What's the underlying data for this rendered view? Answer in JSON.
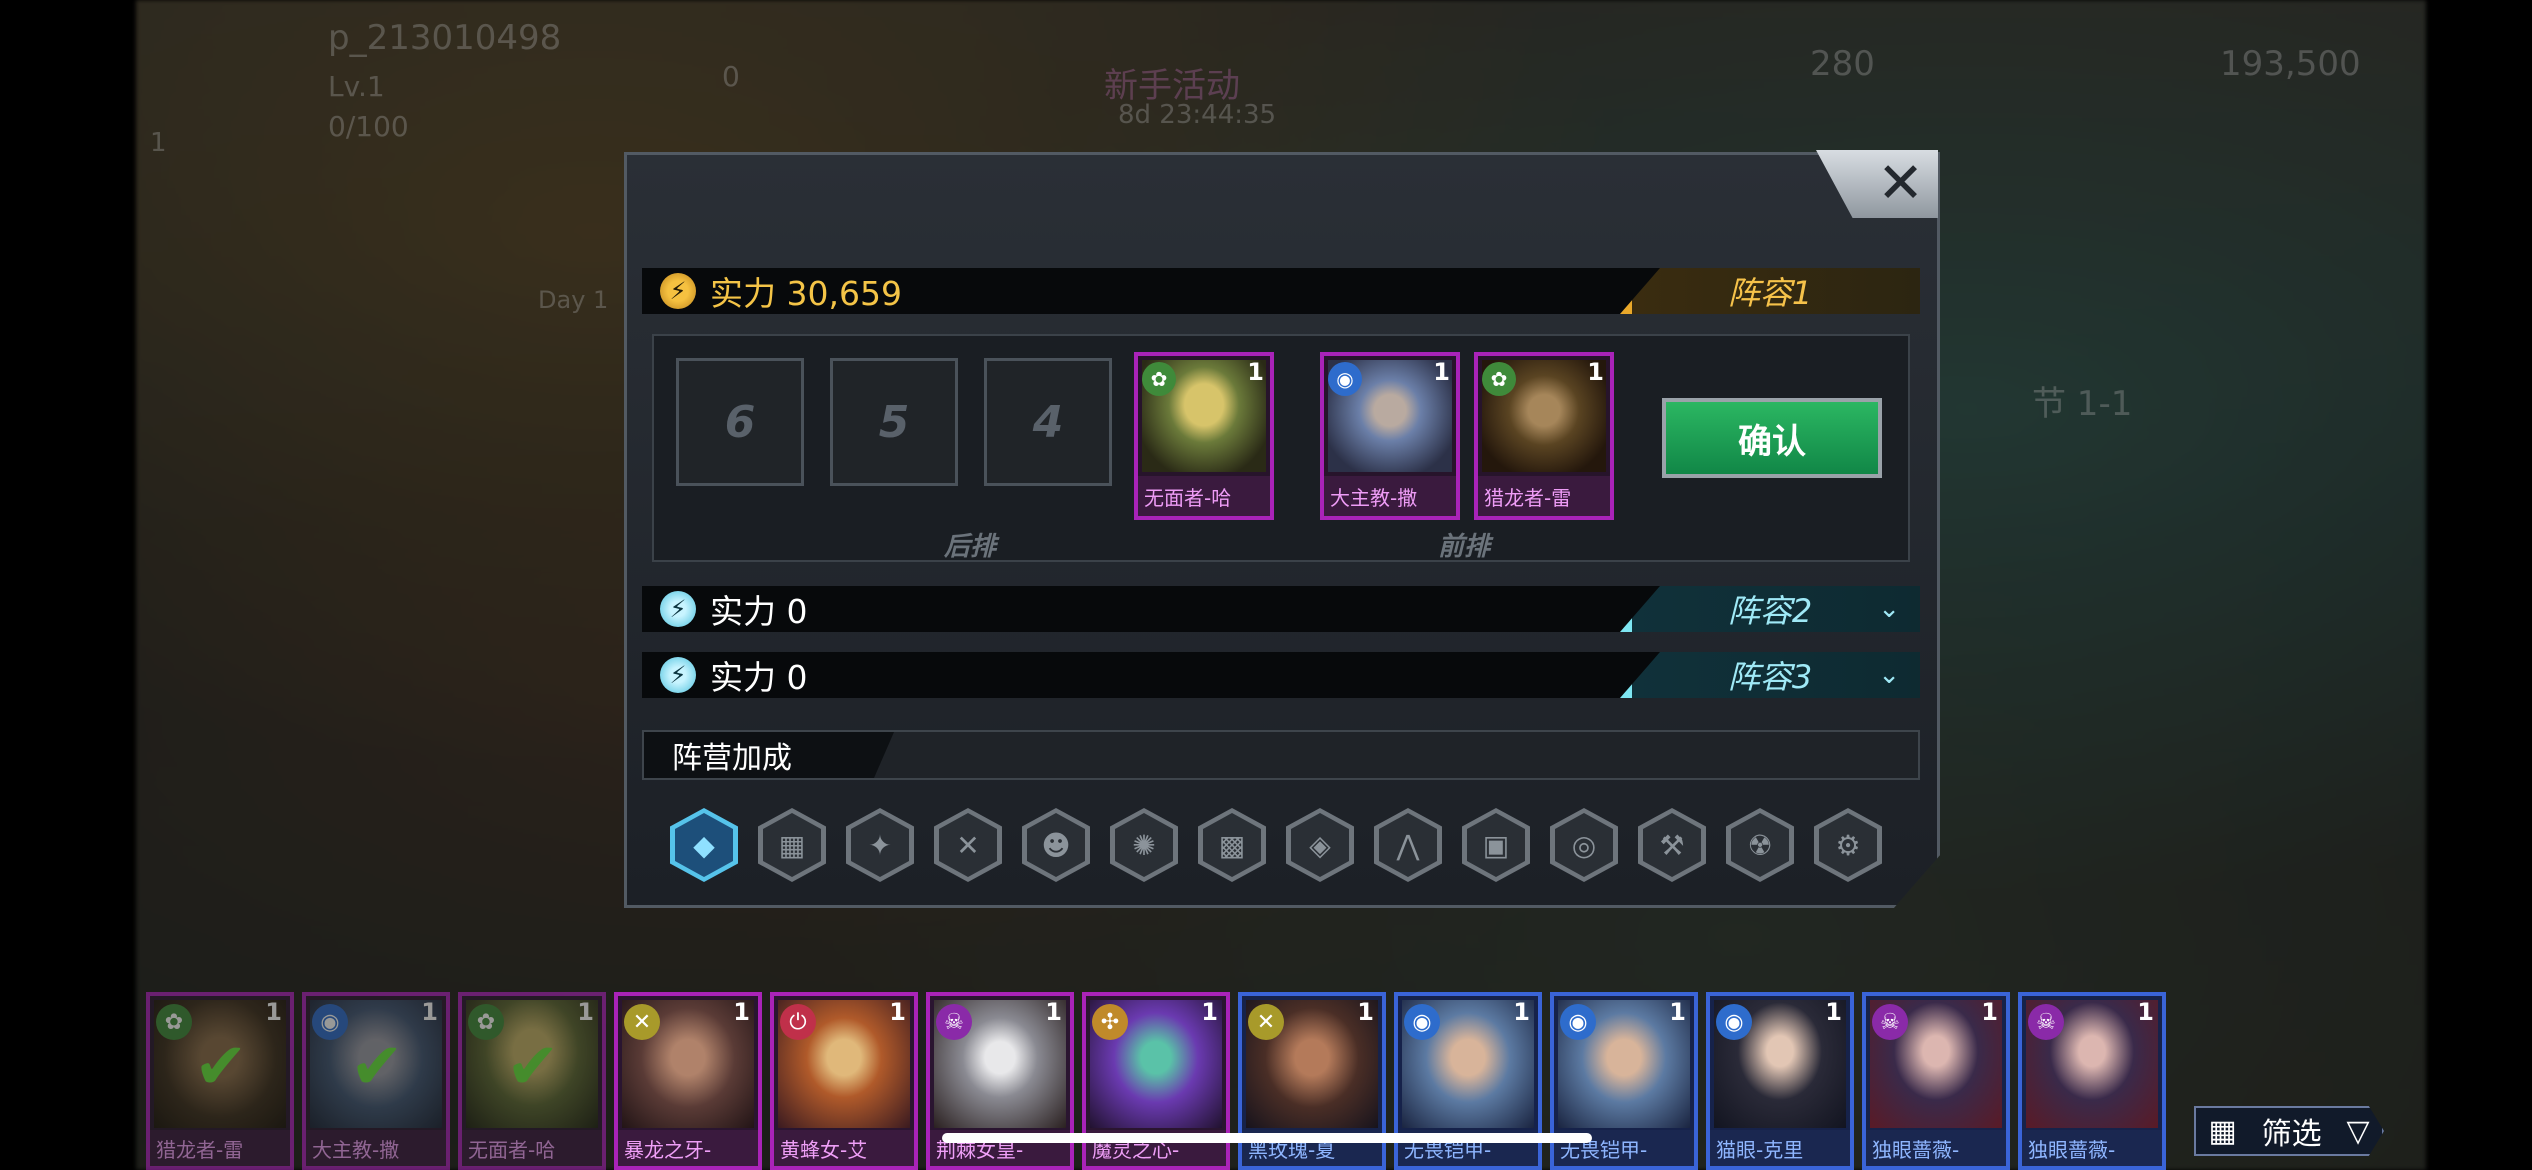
{
  "background_hud": {
    "player_name": "p_213010498",
    "level": "Lv.1",
    "exp": "0/100",
    "gems": "0",
    "event_title": "新手活动",
    "event_timer": "8d 23:44:35",
    "currency_1": "280",
    "currency_2": "193,500",
    "stage": "节 1-1",
    "day": "Day 1",
    "badge": "1"
  },
  "dialog": {
    "close_label": "✕",
    "lineups": [
      {
        "power_label": "实力 30,659",
        "tag": "阵容1",
        "expanded": true
      },
      {
        "power_label": "实力 0",
        "tag": "阵容2",
        "expanded": false
      },
      {
        "power_label": "实力 0",
        "tag": "阵容3",
        "expanded": false
      }
    ],
    "back_row_label": "后排",
    "front_row_label": "前排",
    "empty_slots": [
      "6",
      "5",
      "4"
    ],
    "placed_heroes": [
      {
        "name": "无面者-哈",
        "stars": "1",
        "faction_icon": "nature-icon"
      },
      {
        "name": "大主教-撒",
        "stars": "1",
        "faction_icon": "tech-icon"
      },
      {
        "name": "猎龙者-雷",
        "stars": "1",
        "faction_icon": "nature-icon"
      }
    ],
    "confirm_label": "确认",
    "camp_bonus_label": "阵营加成",
    "camp_icons": [
      "all-factions-icon",
      "camp-2-icon",
      "camp-3-icon",
      "camp-4-icon",
      "camp-5-icon",
      "camp-6-icon",
      "camp-7-icon",
      "camp-8-icon",
      "camp-9-icon",
      "camp-10-icon",
      "camp-11-icon",
      "camp-12-icon",
      "camp-13-icon",
      "camp-14-icon"
    ]
  },
  "roster": [
    {
      "name": "猎龙者-雷",
      "stars": "1",
      "selected": true,
      "tier": "purple"
    },
    {
      "name": "大主教-撒",
      "stars": "1",
      "selected": true,
      "tier": "purple"
    },
    {
      "name": "无面者-哈",
      "stars": "1",
      "selected": true,
      "tier": "purple"
    },
    {
      "name": "暴龙之牙-",
      "stars": "1",
      "selected": false,
      "tier": "purple"
    },
    {
      "name": "黄蜂女-艾",
      "stars": "1",
      "selected": false,
      "tier": "purple"
    },
    {
      "name": "荆棘女皇-",
      "stars": "1",
      "selected": false,
      "tier": "purple"
    },
    {
      "name": "魔灵之心-",
      "stars": "1",
      "selected": false,
      "tier": "purple"
    },
    {
      "name": "黑玫瑰-夏",
      "stars": "1",
      "selected": false,
      "tier": "blue"
    },
    {
      "name": "无畏铠甲-",
      "stars": "1",
      "selected": false,
      "tier": "blue"
    },
    {
      "name": "无畏铠甲-",
      "stars": "1",
      "selected": false,
      "tier": "blue"
    },
    {
      "name": "猫眼-克里",
      "stars": "1",
      "selected": false,
      "tier": "blue"
    },
    {
      "name": "独眼蔷薇-",
      "stars": "1",
      "selected": false,
      "tier": "blue"
    },
    {
      "name": "独眼蔷薇-",
      "stars": "1",
      "selected": false,
      "tier": "blue"
    }
  ],
  "filter_label": "筛选",
  "colors": {
    "gold": "#f4c447",
    "cyan": "#9fe9f6",
    "purple_tier": "#a923b8",
    "blue_tier": "#3a64d8",
    "confirm_green": "#1aa156"
  }
}
